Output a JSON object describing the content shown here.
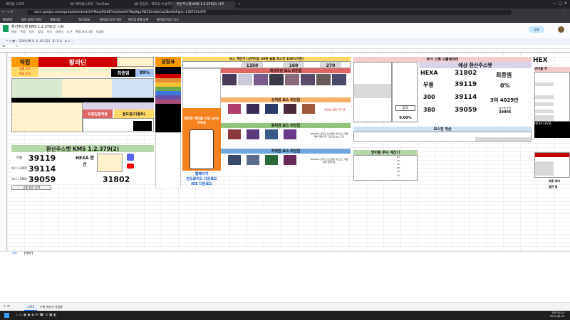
{
  "browser": {
    "tabs": [
      {
        "label": "메이플 스토리"
      },
      {
        "label": "(9) 메이플스토리 - YouTube"
      },
      {
        "label": "(8) 영상도 : 따라의 수상하지 그래"
      },
      {
        "label": "환산주스탯 KMS 1.2.379(2) 시트"
      }
    ],
    "url": "docs.google.com/spreadsheets/d/1YHRkcj9SUNTmn2twVeT9bq9gqYWCZmzbkCwl3bsh0#gid=1387531479",
    "bookmarks": [
      "NAVER",
      "빌런 검색기 폐지",
      "폐쇄지원",
      "YouTube",
      "메이플스토리 정보",
      "메이플 종결 등록",
      "메이플스토리 공식"
    ]
  },
  "sheets": {
    "doc_title": "환산주스탯 KMS 1.2.379(2) 시트",
    "menu": [
      "파일",
      "수정",
      "보기",
      "삽입",
      "서식",
      "데이터",
      "도구",
      "확장 프로그램",
      "도움말"
    ],
    "share_label": "공유",
    "cell_ref": "S6",
    "zoom": "100%",
    "sheet_tabs": [
      "시트1",
      "환산"
    ],
    "bottom_tabs": [
      "스탯 계산기 작업중"
    ]
  },
  "job": {
    "label": "직업",
    "value": "팔라딘"
  },
  "panel_left": {
    "rows": [
      "공통 조건",
      "직업 조건"
    ],
    "final_damage_label": "최종뎀",
    "final_damage": "89%",
    "dropdown_btn": "도핑일괄적용",
    "dropdown_btn2": "올도핑(디폴트)",
    "kms_title": "환산주스탯 KMS 1.2.379(2)",
    "stat_rows": [
      {
        "label": "무릉",
        "value": "39119"
      },
      {
        "label": "보스 (300)",
        "value": "39114"
      },
      {
        "label": "보스 (380)",
        "value": "39059"
      }
    ],
    "hexa_label": "HEXA 환산",
    "hexa_value": "31802",
    "seal_input": "시를 환산 입력"
  },
  "grade": {
    "title": "성장표"
  },
  "boss": {
    "title": "보스 계산기 (상위직업 30분 솔플 최소컷 100%기준)",
    "nums": [
      "1350",
      "160",
      "270"
    ],
    "top_label": "최상위권 보스 라인업",
    "upper_label": "상위권 보스 라인업",
    "mid_label": "중위권 보스 라인업",
    "low_label": "하위권 보스 라인업",
    "normal_note": "NORMAL 난이도 보스들은 하드보스 계뎀 대비 계뎀기준 기준으로 보스 조건",
    "normal_note2": "NORMAL 난이도 보스들은 하드보스 계뎀 대비 계뎀기준",
    "calc_note": "하드보스 결정 3회 기준"
  },
  "ad": {
    "title": "편한한 메이플 인생 with 마하포",
    "web_label": "웹페이지",
    "android": "안드로이드 다운로드",
    "ios": "iOS 다운로드"
  },
  "sim": {
    "title": "추가 스펙 시뮬레이터",
    "expect_title": "예상 환산주스탯",
    "hexa": "HEXA",
    "hexa_value": "31802",
    "mureung": "무릉",
    "mureung_value": "39119",
    "b300": "300",
    "b300_value": "39114",
    "b380": "380",
    "b380_value": "39059",
    "final_label": "최종뎀",
    "final_value": "0%",
    "money": "3억 4029만",
    "real_label": "실스탯 추정",
    "real_value": "39906",
    "none_label": "없음",
    "pct_label": "0.00%"
  },
  "boss_calc": {
    "title": "보스전 계산"
  },
  "defense": {
    "title": "방어율 무시 계산기",
    "rows": [
      "0%",
      "0%",
      "0%",
      "0%",
      "0%",
      "0%"
    ]
  },
  "right_panel": {
    "hexa": "HEX",
    "defense": "방어율 무",
    "stack": "현재",
    "hexa_level": "HEXA LEVEL",
    "final_dmg": "최종 데미",
    "real": "실전 딜"
  },
  "taskbar": {
    "time": "오전 10:23",
    "date": "2023-08-09"
  },
  "colors": {
    "job_bg": "#ff9900",
    "job_red": "#cc0000",
    "green_bar": "#6aa84f",
    "yellow": "#ffd966",
    "ad_orange": "#f6821f",
    "boss_green": "#b6d7a8"
  }
}
